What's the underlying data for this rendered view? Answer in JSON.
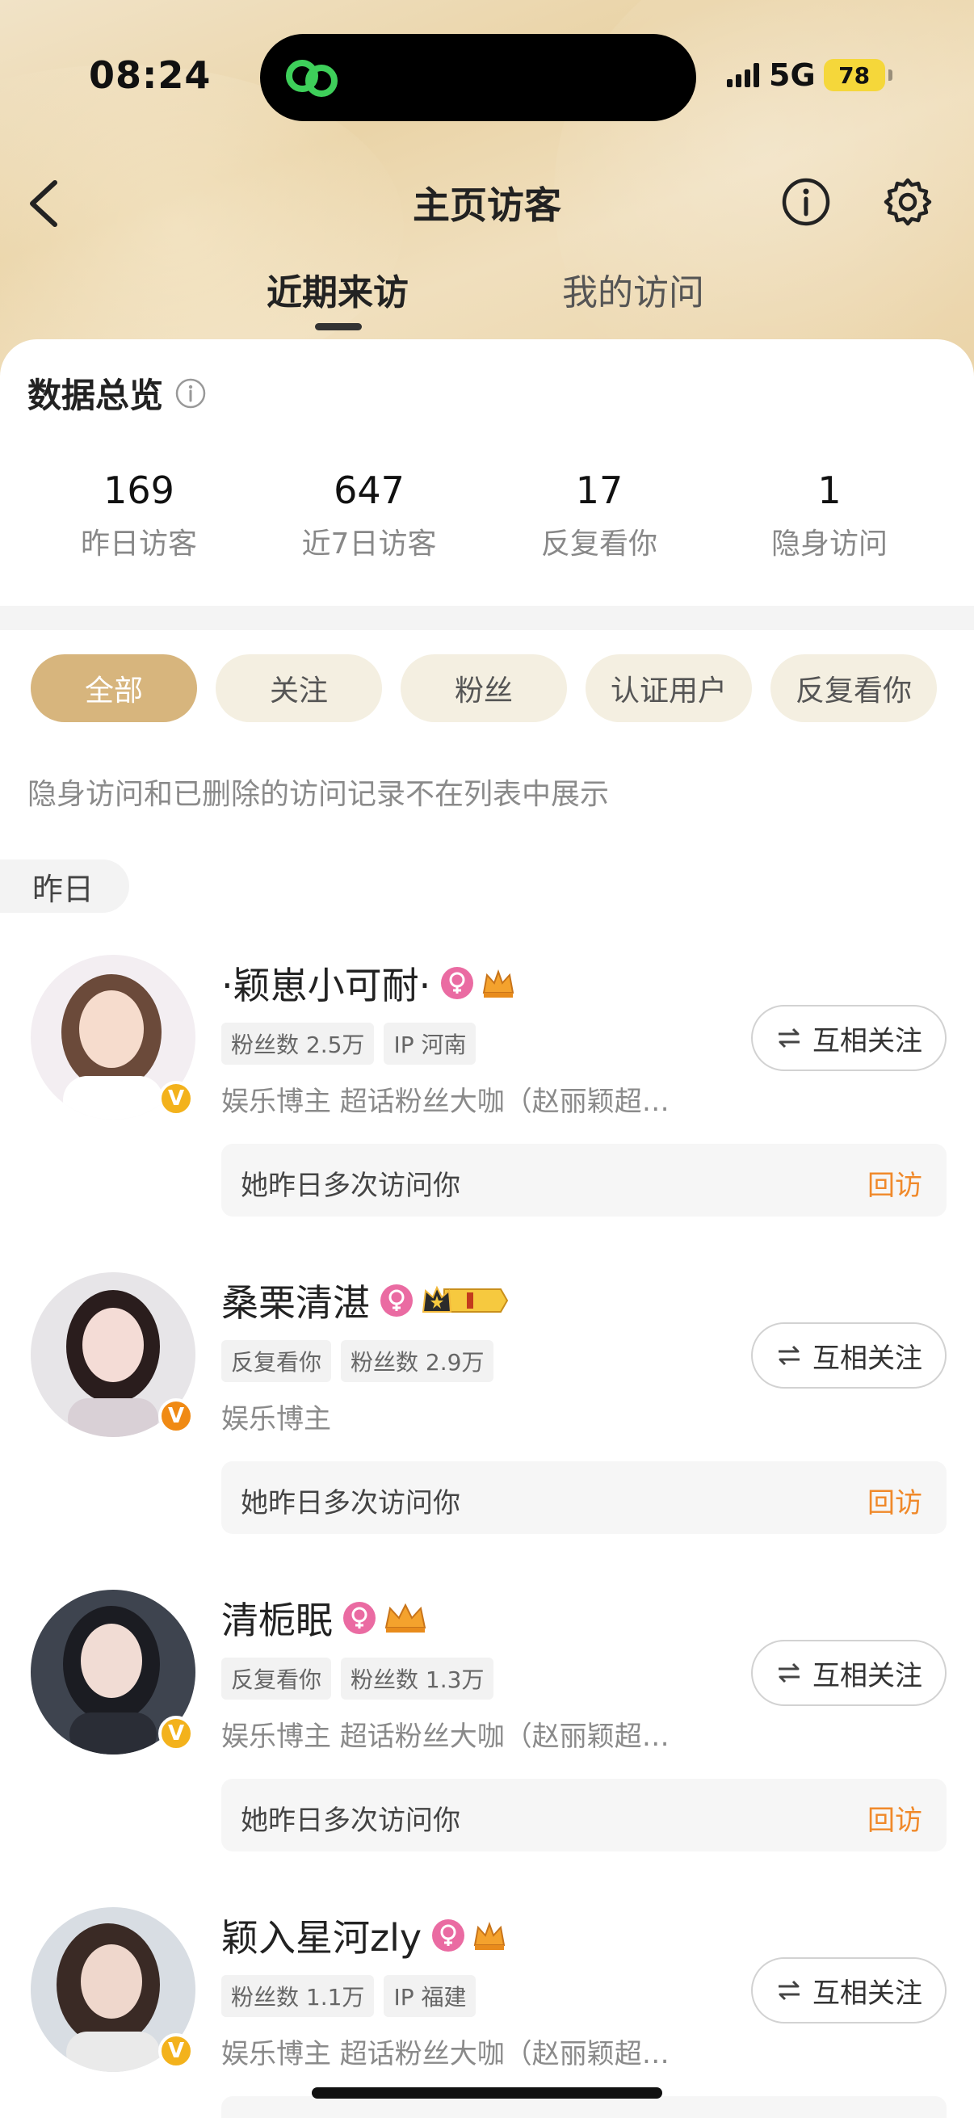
{
  "status_bar": {
    "time": "08:24",
    "network": "5G",
    "battery": "78"
  },
  "nav": {
    "title": "主页访客",
    "back_icon": "chevron-left-icon",
    "info_icon": "info-circle-icon",
    "settings_icon": "gear-icon"
  },
  "tabs": [
    {
      "label": "近期来访",
      "active": true
    },
    {
      "label": "我的访问",
      "active": false
    }
  ],
  "overview": {
    "title": "数据总览",
    "stats": [
      {
        "value": "169",
        "label": "昨日访客"
      },
      {
        "value": "647",
        "label": "近7日访客"
      },
      {
        "value": "17",
        "label": "反复看你"
      },
      {
        "value": "1",
        "label": "隐身访问"
      }
    ]
  },
  "filters": [
    {
      "label": "全部",
      "active": true
    },
    {
      "label": "关注",
      "active": false
    },
    {
      "label": "粉丝",
      "active": false
    },
    {
      "label": "认证用户",
      "active": false
    },
    {
      "label": "反复看你",
      "active": false
    }
  ],
  "notice": "隐身访问和已删除的访问记录不在列表中展示",
  "section_label": "昨日",
  "visitors": [
    {
      "name": "·颖崽小可耐·",
      "tags": [
        "粉丝数 2.5万",
        "IP 河南"
      ],
      "desc": "娱乐博主 超话粉丝大咖（赵丽颖超…",
      "follow_label": "互相关注",
      "visit_text": "她昨日多次访问你",
      "visit_back": "回访",
      "badge_color": "#f3b21c"
    },
    {
      "name": "桑栗清湛",
      "tags": [
        "反复看你",
        "粉丝数 2.9万"
      ],
      "desc": "娱乐博主",
      "follow_label": "互相关注",
      "visit_text": "她昨日多次访问你",
      "visit_back": "回访",
      "badge_color": "#f08a14"
    },
    {
      "name": "清栀眠",
      "tags": [
        "反复看你",
        "粉丝数 1.3万"
      ],
      "desc": "娱乐博主 超话粉丝大咖（赵丽颖超…",
      "follow_label": "互相关注",
      "visit_text": "她昨日多次访问你",
      "visit_back": "回访",
      "badge_color": "#f3b21c"
    },
    {
      "name": "颖入星河zly",
      "tags": [
        "粉丝数 1.1万",
        "IP 福建"
      ],
      "desc": "娱乐博主 超话粉丝大咖（赵丽颖超…",
      "follow_label": "互相关注",
      "badge_color": "#f3b21c"
    }
  ]
}
